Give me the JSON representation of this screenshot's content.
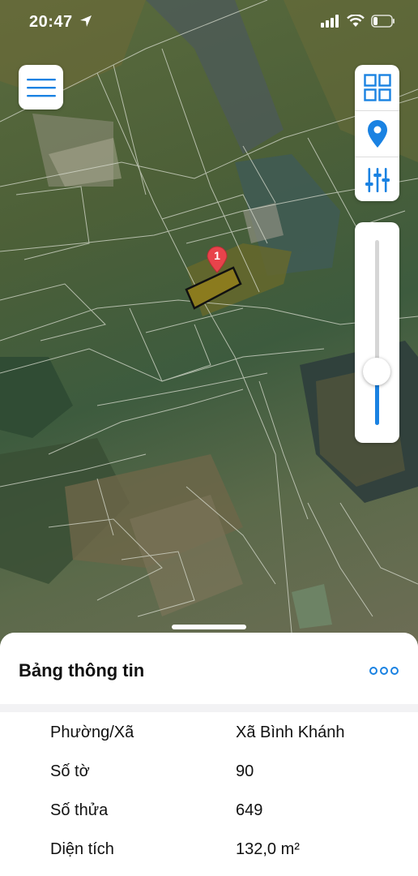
{
  "status_bar": {
    "time": "20:47"
  },
  "map": {
    "marker_label": "1",
    "icons": {
      "menu": "hamburger-menu-icon",
      "layers": "grid-layers-icon",
      "location": "location-pin-icon",
      "filters": "sliders-icon",
      "more": "more-dots-icon"
    },
    "zoom_level": 0.29,
    "accent_color": "#1a82e2",
    "marker_color": "#e8434b",
    "parcel_highlight_color": "#8b7b1e"
  },
  "info_panel": {
    "title": "Bảng thông tin",
    "rows": [
      {
        "label": "Phường/Xã",
        "value": "Xã Bình Khánh"
      },
      {
        "label": "Số tờ",
        "value": "90"
      },
      {
        "label": "Số thửa",
        "value": "649"
      },
      {
        "label": "Diện tích",
        "value": "132,0 m²"
      }
    ]
  }
}
